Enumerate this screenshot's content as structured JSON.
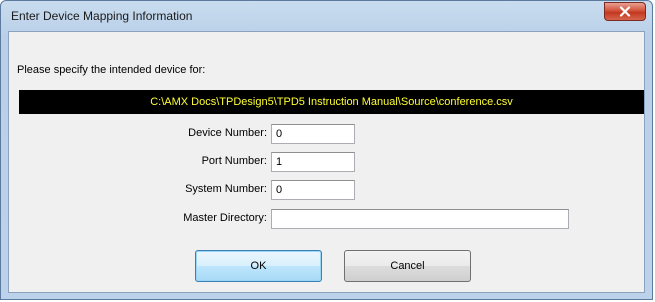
{
  "window": {
    "title": "Enter Device Mapping Information"
  },
  "prompt": "Please specify the intended device for:",
  "file_path": "C:\\AMX Docs\\TPDesign5\\TPD5 Instruction Manual\\Source\\conference.csv",
  "fields": {
    "device_number": {
      "label": "Device Number:",
      "value": "0"
    },
    "port_number": {
      "label": "Port Number:",
      "value": "1"
    },
    "system_number": {
      "label": "System Number:",
      "value": "0"
    },
    "master_directory": {
      "label": "Master Directory:",
      "value": ""
    }
  },
  "buttons": {
    "ok": "OK",
    "cancel": "Cancel"
  },
  "icons": {
    "close": "close-icon"
  },
  "colors": {
    "path_background": "#000000",
    "path_text": "#ffff33",
    "close_button": "#c2381f"
  }
}
